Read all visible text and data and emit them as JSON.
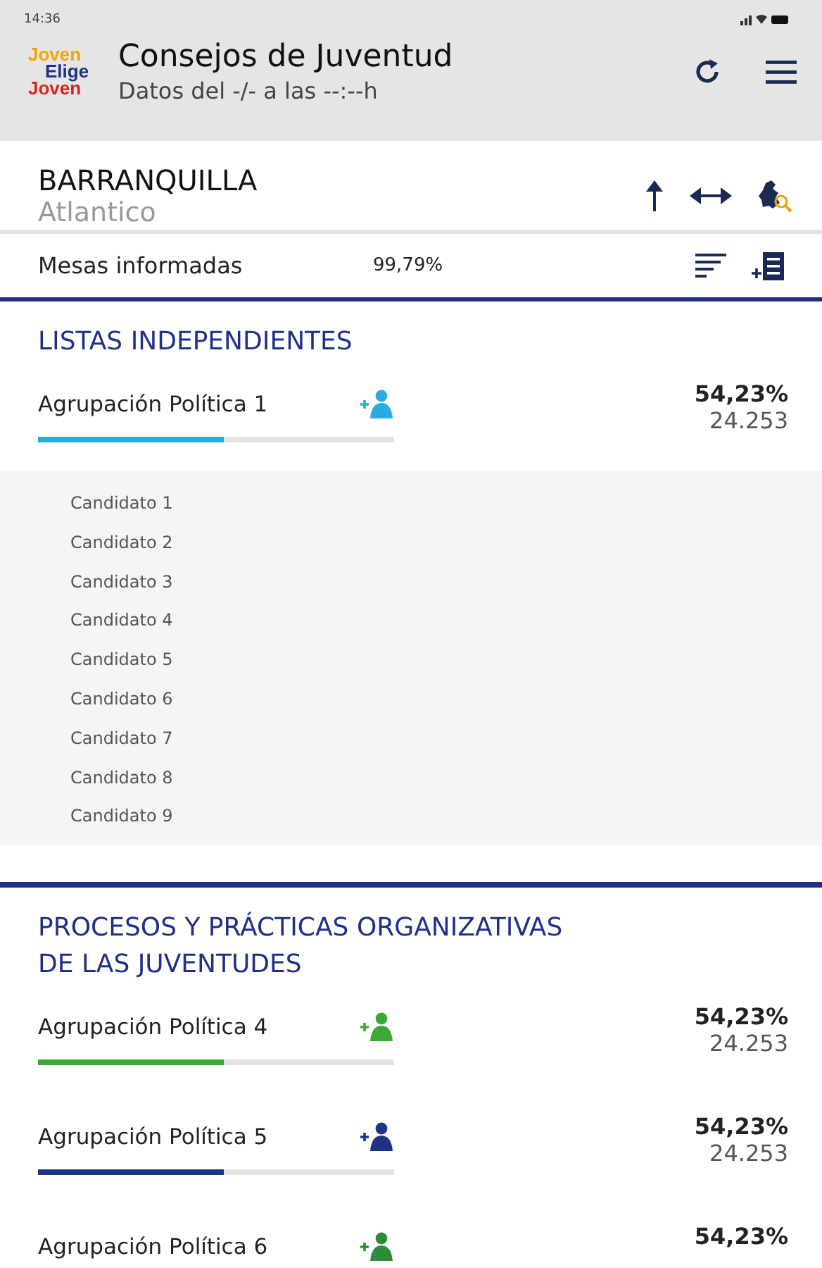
{
  "status_bar": {
    "time": "14:36"
  },
  "header": {
    "logo": [
      "Joven",
      "Elige",
      "Joven"
    ],
    "title": "Consejos de Juventud",
    "subtitle": "Datos del -/- a las --:--h"
  },
  "location": {
    "city": "BARRANQUILLA",
    "region": "Atlantico"
  },
  "summary": {
    "label": "Mesas informadas",
    "value": "99,79%"
  },
  "sections": [
    {
      "title": "LISTAS INDEPENDIENTES",
      "groups": [
        {
          "name": "Agrupación Política 1",
          "color": "#29abe2",
          "level": 0.52,
          "percent": "54,23%",
          "votes": "24.253",
          "candidates": [
            "Candidato 1",
            "Candidato 2",
            "Candidato 3",
            "Candidato 4",
            "Candidato 5",
            "Candidato 6",
            "Candidato 7",
            "Candidato 8",
            "Candidato 9"
          ]
        }
      ]
    },
    {
      "title": "PROCESOS Y PRÁCTICAS ORGANIZATIVAS DE LAS JUVENTUDES",
      "groups": [
        {
          "name": "Agrupación Política 4",
          "color": "#3aa935",
          "level": 0.52,
          "percent": "54,23%",
          "votes": "24.253"
        },
        {
          "name": "Agrupación Política 5",
          "color": "#1f3285",
          "level": 0.52,
          "percent": "54,23%",
          "votes": "24.253"
        },
        {
          "name": "Agrupación Política 6",
          "color": "#2e8b3a",
          "percent": "54,23%"
        }
      ]
    }
  ]
}
